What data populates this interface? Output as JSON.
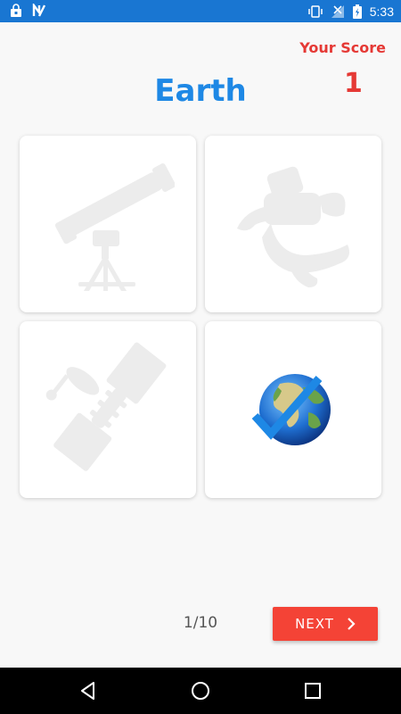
{
  "status_bar": {
    "time": "5:33",
    "left_icons": [
      "lock-bag-icon",
      "n-notification-icon"
    ],
    "right_icons": [
      "vibrate-icon",
      "no-signal-icon",
      "battery-charging-icon"
    ]
  },
  "score": {
    "label": "Your Score",
    "value": "1"
  },
  "question": {
    "word": "Earth"
  },
  "options": [
    {
      "icon": "telescope-icon",
      "state": "faded"
    },
    {
      "icon": "astronaut-icon",
      "state": "faded"
    },
    {
      "icon": "satellite-icon",
      "state": "faded"
    },
    {
      "icon": "earth-globe-icon",
      "state": "correct-checked"
    }
  ],
  "pager": {
    "text": "1/10"
  },
  "next_button": {
    "label": "NEXT"
  },
  "colors": {
    "status_bar": "#1976D2",
    "title": "#1E88E5",
    "score": "#e53935",
    "next_button": "#F44336",
    "faded_icon": "#ececec",
    "check": "#1E88E5"
  },
  "nav_bar": {
    "buttons": [
      "back-icon",
      "home-icon",
      "recents-icon"
    ]
  }
}
